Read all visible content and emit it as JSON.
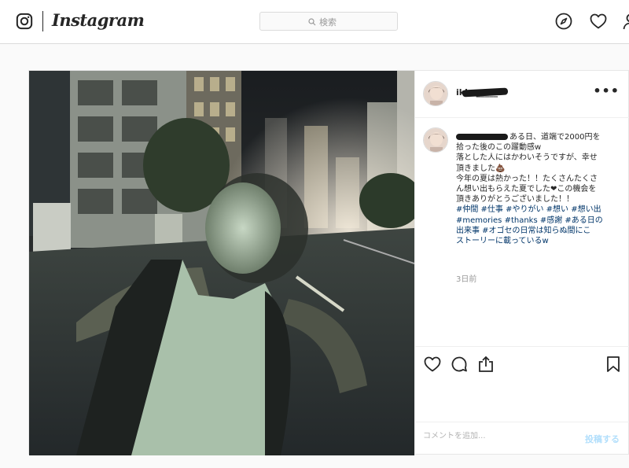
{
  "app": {
    "name": "Instagram"
  },
  "nav": {
    "search_placeholder": "検索",
    "icons": [
      "instagram-glyph-icon",
      "search-icon",
      "compass-icon",
      "heart-icon",
      "profile-icon"
    ]
  },
  "post": {
    "username": "ikko_____",
    "caption_lines": [
      {
        "text": "ある日、道端で2000円を",
        "hashtag": false
      },
      {
        "text": "拾った後のこの躍動感w",
        "hashtag": false
      },
      {
        "text": "落とした人にはかわいそうですが、幸せ",
        "hashtag": false
      },
      {
        "text": "頂きました💩",
        "hashtag": false
      },
      {
        "text": "今年の夏は熱かった！！たくさんたくさ",
        "hashtag": false
      },
      {
        "text": "ん想い出もらえた夏でした❤この機会を",
        "hashtag": false
      },
      {
        "text": "頂きありがとうございました！！",
        "hashtag": false
      },
      {
        "text": "#仲間 #仕事 #やりがい #想い #想い出",
        "hashtag": true
      },
      {
        "text": "#memories #thanks #感謝 #ある日の",
        "hashtag": true
      },
      {
        "text": "出来事 #オゴセの日常は知らぬ間にこ",
        "hashtag": true
      },
      {
        "text": "ストーリーに載っているw",
        "hashtag": true
      }
    ],
    "time_ago": "3日前",
    "comment_placeholder": "コメントを追加...",
    "post_button": "投稿する",
    "more_label": "•••"
  },
  "colors": {
    "link": "#003569",
    "muted": "#999999",
    "border": "#dbdbdb",
    "post_disabled": "#b2dffc"
  }
}
